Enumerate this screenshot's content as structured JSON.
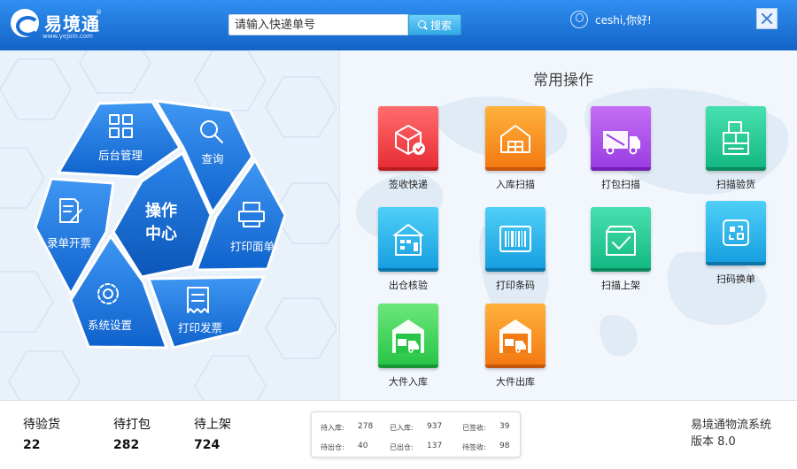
{
  "header": {
    "logo_text": "易境通",
    "logo_reg": "®",
    "logo_url": "www.yejoin.com",
    "search_placeholder": "请输入快递单号",
    "search_button": "搜索",
    "greeting": "ceshi,你好!"
  },
  "operation_menu": {
    "center_line1": "操作",
    "center_line2": "中心",
    "items": [
      {
        "label": "后台管理",
        "icon": "grid-icon"
      },
      {
        "label": "查询",
        "icon": "search-icon"
      },
      {
        "label": "打印面单",
        "icon": "printer-icon"
      },
      {
        "label": "打印发票",
        "icon": "receipt-icon"
      },
      {
        "label": "系统设置",
        "icon": "gear-icon"
      },
      {
        "label": "录单开票",
        "icon": "edit-document-icon"
      }
    ]
  },
  "common_ops": {
    "title": "常用操作",
    "tiles": [
      {
        "label": "签收快递",
        "icon": "package-check-icon",
        "color": "#e82d36"
      },
      {
        "label": "入库扫描",
        "icon": "warehouse-in-icon",
        "color": "#f37a12"
      },
      {
        "label": "打包扫描",
        "icon": "truck-icon",
        "color": "#9a3ee2"
      },
      {
        "label": "扫描验货",
        "icon": "boxes-inspect-icon",
        "color": "#14b983"
      },
      {
        "label": "出仓核验",
        "icon": "warehouse-out-icon",
        "color": "#179fe0"
      },
      {
        "label": "打印条码",
        "icon": "barcode-icon",
        "color": "#179fe0"
      },
      {
        "label": "扫描上架",
        "icon": "box-check-icon",
        "color": "#14b983"
      },
      {
        "label": "扫码换单",
        "icon": "swap-icon",
        "color": "#179fe0"
      },
      {
        "label": "大件入库",
        "icon": "forklift-in-icon",
        "color": "#28c548"
      },
      {
        "label": "大件出库",
        "icon": "forklift-out-icon",
        "color": "#f37a12"
      }
    ]
  },
  "footer": {
    "stats": [
      {
        "label": "待验货",
        "value": "22"
      },
      {
        "label": "待打包",
        "value": "282"
      },
      {
        "label": "待上架",
        "value": "724"
      }
    ],
    "mini_stats": [
      {
        "label": "待入库:",
        "value": "278"
      },
      {
        "label": "已入库:",
        "value": "937"
      },
      {
        "label": "已签收:",
        "value": "39"
      },
      {
        "label": "待出仓:",
        "value": "40"
      },
      {
        "label": "已出仓:",
        "value": "137"
      },
      {
        "label": "待签收:",
        "value": "98"
      }
    ],
    "system_name": "易境通物流系统",
    "version": "版本 8.0"
  }
}
